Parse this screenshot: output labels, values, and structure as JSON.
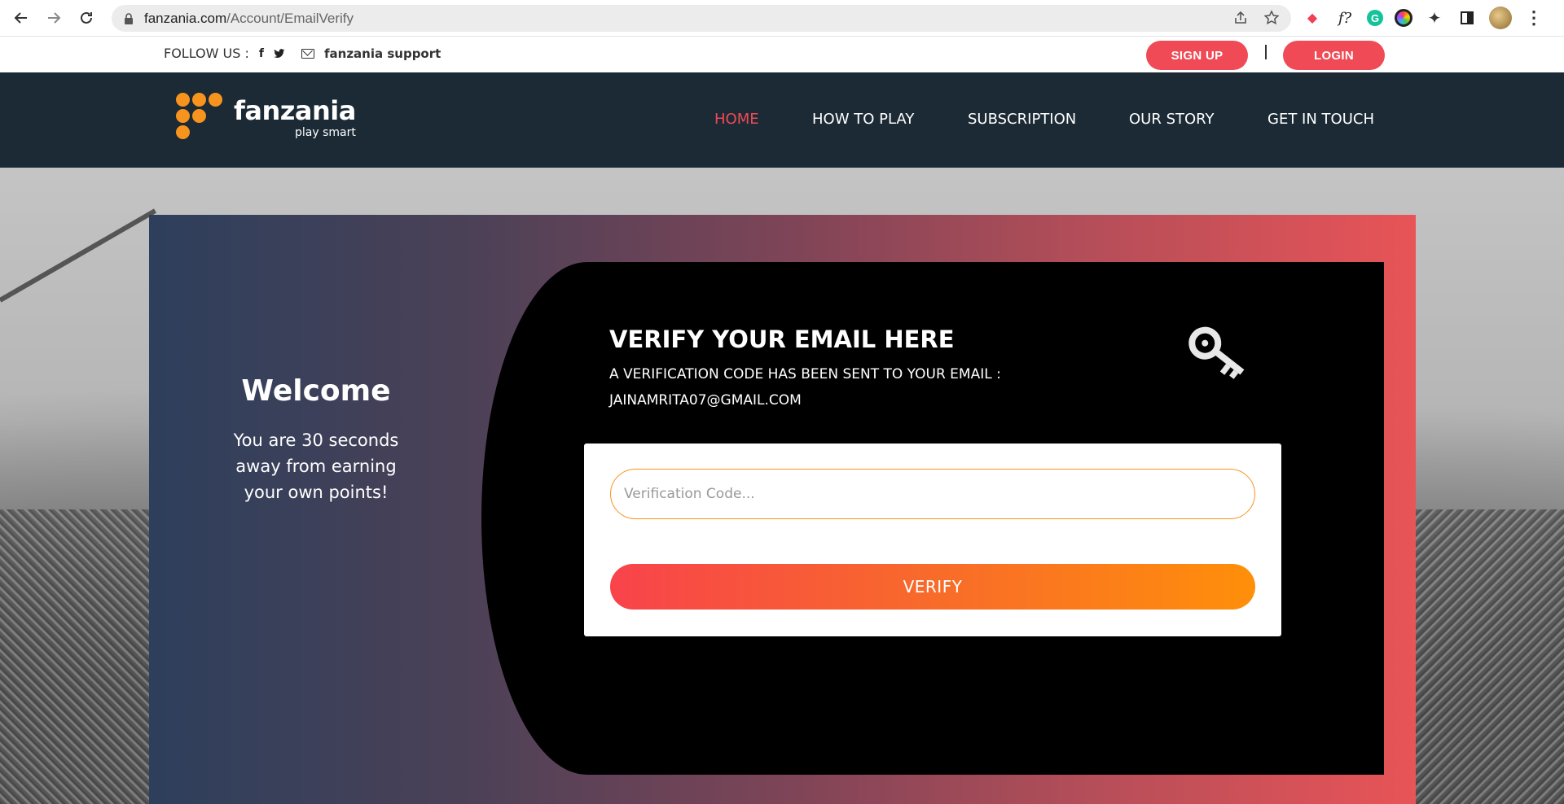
{
  "browser": {
    "url_host": "fanzania.com",
    "url_path": "/Account/EmailVerify"
  },
  "topbar": {
    "follow_label": "FOLLOW US :",
    "support_label": "fanzania support",
    "signup_label": "SIGN UP",
    "login_label": "LOGIN"
  },
  "brand": {
    "name": "fanzania",
    "tagline": "play smart",
    "accent_color": "#f7941d"
  },
  "nav": {
    "items": [
      {
        "label": "HOME",
        "active": true
      },
      {
        "label": "HOW TO PLAY"
      },
      {
        "label": "SUBSCRIPTION"
      },
      {
        "label": "OUR STORY"
      },
      {
        "label": "GET IN TOUCH"
      }
    ]
  },
  "welcome": {
    "title": "Welcome",
    "line1": "You are 30 seconds",
    "line2": "away from earning",
    "line3": "your own points!"
  },
  "verify": {
    "title": "VERIFY YOUR EMAIL HERE",
    "message": "A VERIFICATION CODE HAS BEEN SENT TO YOUR EMAIL :",
    "email": "JAINAMRITA07@GMAIL.COM",
    "input_placeholder": "Verification Code...",
    "input_value": "",
    "button_label": "VERIFY",
    "icon": "key-icon"
  },
  "colors": {
    "nav_bg": "#1b2a35",
    "pill_red": "#ef4a55",
    "button_start": "#f8434b",
    "button_end": "#ff8f0a"
  }
}
